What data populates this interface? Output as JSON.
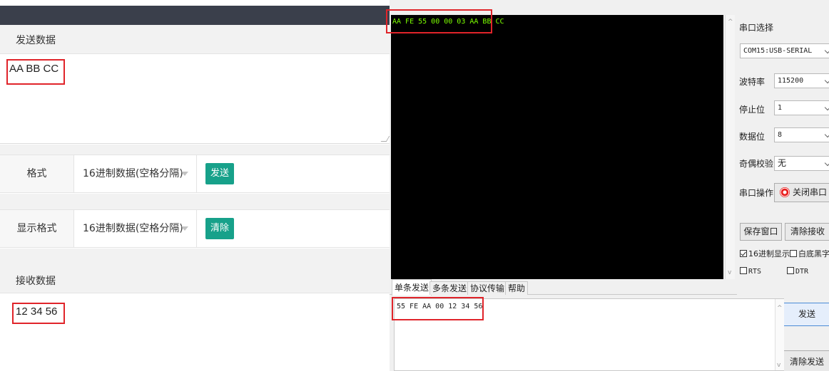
{
  "left_panel": {
    "send_section_title": "发送数据",
    "send_data_value": "AA BB CC",
    "format_row": {
      "label": "格式",
      "selected": "16进制数据(空格分隔)",
      "button": "发送"
    },
    "display_row": {
      "label": "显示格式",
      "selected": "16进制数据(空格分隔)",
      "button": "清除"
    },
    "receive_section_title": "接收数据",
    "receive_data_value": "12  34  56"
  },
  "serial_tool": {
    "receive_text": "AA FE 55 00 00 03 AA BB CC",
    "settings": {
      "port_label": "串口选择",
      "port_value": "COM15:USB-SERIAL",
      "baud_label": "波特率",
      "baud_value": "115200",
      "stop_label": "停止位",
      "stop_value": "1",
      "data_label": "数据位",
      "data_value": "8",
      "parity_label": "奇偶校验",
      "parity_value": "无",
      "op_label": "串口操作",
      "op_button": "关闭串口"
    },
    "save_button": "保存窗口",
    "clear_recv_button": "清除接收",
    "hex_display_label": "16进制显示",
    "white_bg_label": "白底黑字",
    "rts_label": "RTS",
    "dtr_label": "DTR",
    "tabs": [
      "单条发送",
      "多条发送",
      "协议传输",
      "帮助"
    ],
    "send_text": "55 FE AA 00 12 34 56",
    "send_button": "发送",
    "clear_send_button": "清除发送"
  },
  "colors": {
    "accent_green": "#17a18a",
    "highlight_red": "#e0242a",
    "terminal_text": "#7cff00"
  }
}
